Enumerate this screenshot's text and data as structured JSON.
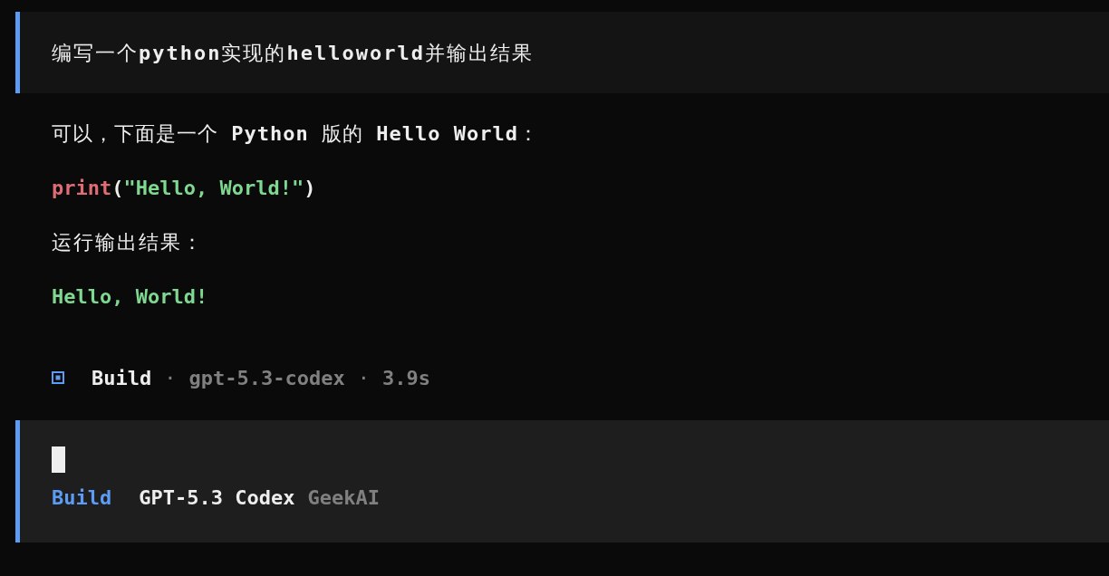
{
  "user_message": {
    "text": "编写一个**python**实现的**helloworld**并输出结果"
  },
  "response": {
    "intro": "可以，下面是一个 **Python** 版的 **Hello World**：",
    "code": [
      {
        "kind": "function",
        "text": "print"
      },
      {
        "kind": "punct",
        "text": "("
      },
      {
        "kind": "string",
        "text": "\"Hello, World!\""
      },
      {
        "kind": "punct",
        "text": ")"
      }
    ],
    "output_label": "运行输出结果：",
    "output": "Hello, World!"
  },
  "run_info": {
    "agent": "Build",
    "separator_1": "·",
    "model": "gpt-5.3-codex",
    "separator_2": "·",
    "duration": "3.9s"
  },
  "prompt": {
    "mode": "Build",
    "model": "GPT-5.3 Codex",
    "provider": "GeekAI"
  }
}
